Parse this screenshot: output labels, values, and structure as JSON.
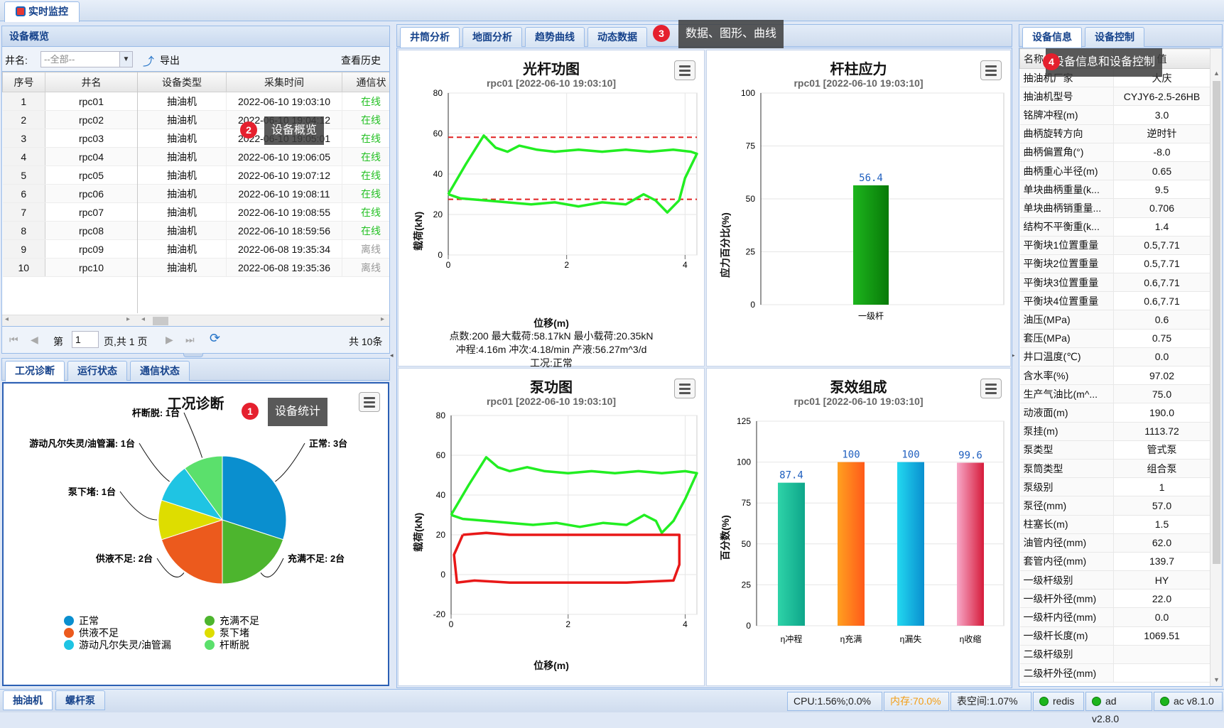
{
  "app": {
    "tab_title": "实时监控"
  },
  "overview": {
    "title": "设备概览",
    "well_label": "井名:",
    "well_select": "--全部--",
    "export": "导出",
    "history": "查看历史",
    "columns": [
      "序号",
      "井名",
      "设备类型",
      "采集时间",
      "通信状"
    ],
    "rows": [
      {
        "n": "1",
        "name": "rpc01",
        "type": "抽油机",
        "time": "2022-06-10 19:03:10",
        "status": "在线"
      },
      {
        "n": "2",
        "name": "rpc02",
        "type": "抽油机",
        "time": "2022-06-10 19:04:12",
        "status": "在线"
      },
      {
        "n": "3",
        "name": "rpc03",
        "type": "抽油机",
        "time": "2022-06-10 19:05:01",
        "status": "在线"
      },
      {
        "n": "4",
        "name": "rpc04",
        "type": "抽油机",
        "time": "2022-06-10 19:06:05",
        "status": "在线"
      },
      {
        "n": "5",
        "name": "rpc05",
        "type": "抽油机",
        "time": "2022-06-10 19:07:12",
        "status": "在线"
      },
      {
        "n": "6",
        "name": "rpc06",
        "type": "抽油机",
        "time": "2022-06-10 19:08:11",
        "status": "在线"
      },
      {
        "n": "7",
        "name": "rpc07",
        "type": "抽油机",
        "time": "2022-06-10 19:08:55",
        "status": "在线"
      },
      {
        "n": "8",
        "name": "rpc08",
        "type": "抽油机",
        "time": "2022-06-10 18:59:56",
        "status": "在线"
      },
      {
        "n": "9",
        "name": "rpc09",
        "type": "抽油机",
        "time": "2022-06-08 19:35:34",
        "status": "离线"
      },
      {
        "n": "10",
        "name": "rpc10",
        "type": "抽油机",
        "time": "2022-06-08 19:35:36",
        "status": "离线"
      }
    ],
    "pager": {
      "page_label": "第",
      "page": "1",
      "of": "页,共 1 页",
      "total": "共 10条"
    }
  },
  "bottom_tabs": [
    "工况诊断",
    "运行状态",
    "通信状态"
  ],
  "diag": {
    "title": "工况诊断"
  },
  "center_tabs": [
    "井筒分析",
    "地面分析",
    "趋势曲线",
    "动态数据"
  ],
  "right_tabs": [
    "设备信息",
    "设备控制"
  ],
  "tips": {
    "t1": "设备统计",
    "t2": "设备概览",
    "t3": "数据、图形、曲线",
    "t4": "设备信息和设备控制"
  },
  "badges": {
    "b1": "1",
    "b2": "2",
    "b3": "3",
    "b4": "4"
  },
  "charts": {
    "guang": {
      "title": "光杆功图",
      "sub": "rpc01 [2022-06-10 19:03:10]",
      "ylabel": "载荷(kN)",
      "xlabel": "位移(m)",
      "info1": "点数:200 最大载荷:58.17kN 最小载荷:20.35kN",
      "info2": "冲程:4.16m 冲次:4.18/min 产液:56.27m^3/d",
      "info3": "工况:正常"
    },
    "gan": {
      "title": "杆柱应力",
      "sub": "rpc01 [2022-06-10 19:03:10]",
      "ylabel": "应力百分比(%)",
      "bar_label": "56.4",
      "category": "一级杆"
    },
    "beng": {
      "title": "泵功图",
      "sub": "rpc01 [2022-06-10 19:03:10]",
      "ylabel": "载荷(kN)",
      "xlabel": "位移(m)"
    },
    "xiao": {
      "title": "泵效组成",
      "sub": "rpc01 [2022-06-10 19:03:10]",
      "ylabel": "百分数(%)"
    }
  },
  "chart_data": [
    {
      "type": "line",
      "title": "光杆功图",
      "xlabel": "位移(m)",
      "ylabel": "载荷(kN)",
      "xlim": [
        0,
        4.2
      ],
      "ylim": [
        0,
        80
      ],
      "xticks": [
        "0",
        "2",
        "4"
      ],
      "yticks": [
        "0",
        "20",
        "40",
        "60",
        "80"
      ],
      "max_line": 58.17,
      "min_line": 27.5
    },
    {
      "type": "bar",
      "title": "杆柱应力",
      "ylabel": "应力百分比(%)",
      "categories": [
        "一级杆"
      ],
      "values": [
        56.4
      ],
      "ylim": [
        0,
        100
      ],
      "yticks": [
        "0",
        "25",
        "50",
        "75",
        "100"
      ]
    },
    {
      "type": "line",
      "title": "泵功图",
      "xlabel": "位移(m)",
      "ylabel": "载荷(kN)",
      "xlim": [
        0,
        4.2
      ],
      "ylim": [
        -20,
        80
      ],
      "xticks": [
        "0",
        "2",
        "4"
      ],
      "yticks": [
        "-20",
        "0",
        "20",
        "40",
        "60",
        "80"
      ]
    },
    {
      "type": "bar",
      "title": "泵效组成",
      "ylabel": "百分数(%)",
      "categories": [
        "η冲程",
        "η充满",
        "η漏失",
        "η收缩"
      ],
      "values": [
        87.4,
        100,
        100,
        99.6
      ],
      "labels": [
        "87.4",
        "100",
        "100",
        "99.6"
      ],
      "ylim": [
        0,
        125
      ],
      "yticks": [
        "0",
        "25",
        "50",
        "75",
        "100",
        "125"
      ]
    },
    {
      "type": "pie",
      "title": "工况诊断",
      "labels": [
        "正常: 3台",
        "充满不足: 2台",
        "供液不足: 2台",
        "泵下堵: 1台",
        "游动凡尔失灵/油管漏: 1台",
        "杆断脱: 1台"
      ],
      "values": [
        3,
        2,
        2,
        1,
        1,
        1
      ],
      "legend": [
        "正常",
        "充满不足",
        "供液不足",
        "泵下堵",
        "游动凡尔失灵/油管漏",
        "杆断脱"
      ],
      "colors": [
        "#0a8fcf",
        "#4db52e",
        "#ec5a1d",
        "#dedd00",
        "#1fc4e3",
        "#5be06c"
      ]
    }
  ],
  "info": {
    "header_name": "名称",
    "header_value": "值",
    "rows": [
      [
        "抽油机厂家",
        "大庆"
      ],
      [
        "抽油机型号",
        "CYJY6-2.5-26HB"
      ],
      [
        "铭牌冲程(m)",
        "3.0"
      ],
      [
        "曲柄旋转方向",
        "逆时针"
      ],
      [
        "曲柄偏置角(°)",
        "-8.0"
      ],
      [
        "曲柄重心半径(m)",
        "0.65"
      ],
      [
        "单块曲柄重量(k...",
        "9.5"
      ],
      [
        "单块曲柄销重量...",
        "0.706"
      ],
      [
        "结构不平衡重(k...",
        "1.4"
      ],
      [
        "平衡块1位置重量",
        "0.5,7.71"
      ],
      [
        "平衡块2位置重量",
        "0.5,7.71"
      ],
      [
        "平衡块3位置重量",
        "0.6,7.71"
      ],
      [
        "平衡块4位置重量",
        "0.6,7.71"
      ],
      [
        "油压(MPa)",
        "0.6"
      ],
      [
        "套压(MPa)",
        "0.75"
      ],
      [
        "井口温度(℃)",
        "0.0"
      ],
      [
        "含水率(%)",
        "97.02"
      ],
      [
        "生产气油比(m^...",
        "75.0"
      ],
      [
        "动液面(m)",
        "190.0"
      ],
      [
        "泵挂(m)",
        "1113.72"
      ],
      [
        "泵类型",
        "管式泵"
      ],
      [
        "泵筒类型",
        "组合泵"
      ],
      [
        "泵级别",
        "1"
      ],
      [
        "泵径(mm)",
        "57.0"
      ],
      [
        "柱塞长(m)",
        "1.5"
      ],
      [
        "油管内径(mm)",
        "62.0"
      ],
      [
        "套管内径(mm)",
        "139.7"
      ],
      [
        "一级杆级别",
        "HY"
      ],
      [
        "一级杆外径(mm)",
        "22.0"
      ],
      [
        "一级杆内径(mm)",
        "0.0"
      ],
      [
        "一级杆长度(m)",
        "1069.51"
      ],
      [
        "二级杆级别",
        ""
      ],
      [
        "二级杆外径(mm)",
        ""
      ]
    ]
  },
  "footer": {
    "tabs": [
      "抽油机",
      "螺杆泵"
    ],
    "cpu": "CPU:1.56%;0.0%",
    "mem": "内存:70.0%",
    "table": "表空间:1.07%",
    "redis": "redis",
    "ad": "ad v2.8.0",
    "ac": "ac v8.1.0"
  }
}
